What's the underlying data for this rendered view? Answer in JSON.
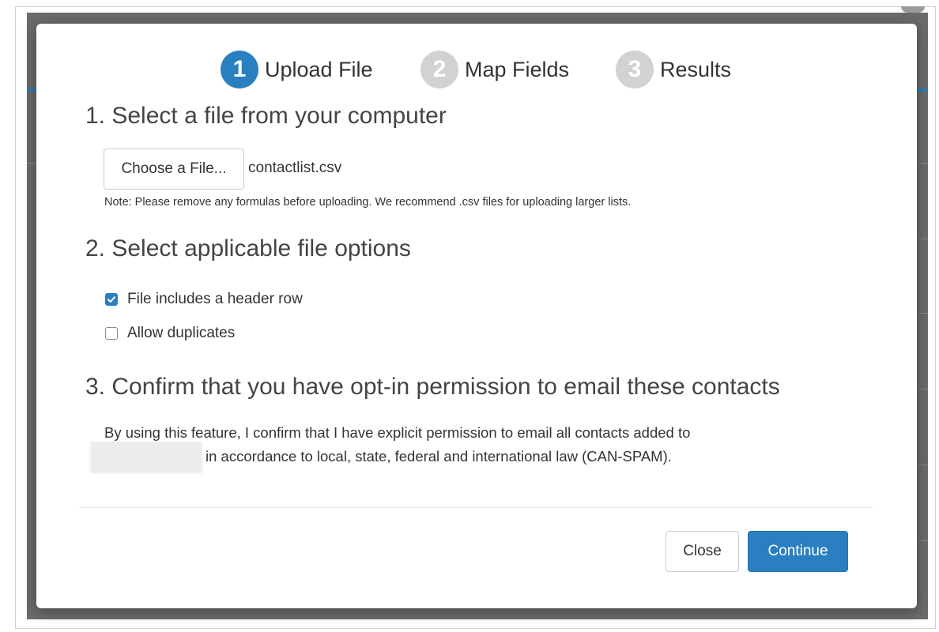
{
  "wizard": {
    "steps": [
      {
        "number": "1",
        "label": "Upload File",
        "state": "active"
      },
      {
        "number": "2",
        "label": "Map Fields",
        "state": "inactive"
      },
      {
        "number": "3",
        "label": "Results",
        "state": "inactive"
      }
    ]
  },
  "section1": {
    "heading": "1. Select a file from your computer",
    "choose_button": "Choose a File...",
    "file_name": "contactlist.csv",
    "note": "Note: Please remove any formulas before uploading. We recommend .csv files for uploading larger lists."
  },
  "section2": {
    "heading": "2. Select applicable file options",
    "options": [
      {
        "label": "File includes a header row",
        "checked": true
      },
      {
        "label": "Allow duplicates",
        "checked": false
      }
    ]
  },
  "section3": {
    "heading": "3. Confirm that you have opt-in permission to email these contacts",
    "line1": "By using this feature, I confirm that I have explicit permission to email all contacts added to",
    "line2": "in accordance to local, state, federal and international law (CAN-SPAM)."
  },
  "footer": {
    "close_label": "Close",
    "continue_label": "Continue"
  },
  "colors": {
    "accent": "#2a7fc0",
    "inactive_step": "#d2d2d2",
    "backdrop": "#6b6b6b"
  },
  "icons": {
    "checkmark": "checkmark-icon"
  }
}
